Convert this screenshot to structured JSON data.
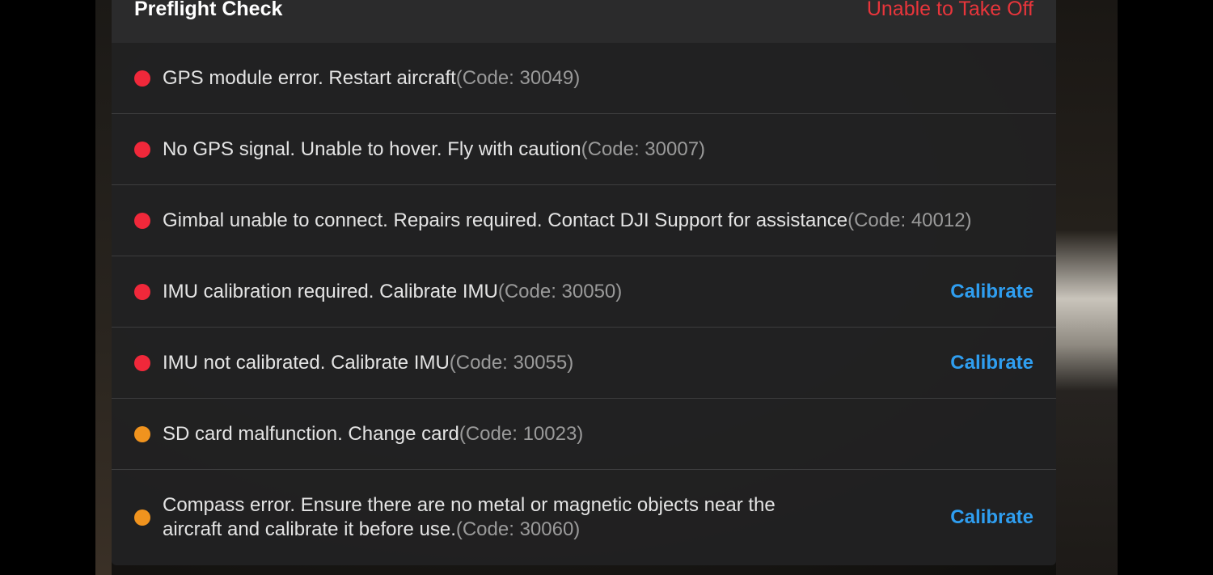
{
  "header": {
    "title": "Preflight Check",
    "status": "Unable to Take Off",
    "status_color": "#e8353b"
  },
  "colors": {
    "error": "#f0283a",
    "warning": "#f0931e",
    "action": "#2f9ef0"
  },
  "items": [
    {
      "severity": "error",
      "message": "GPS module error. Restart aircraft",
      "code": "(Code: 30049)",
      "action": null
    },
    {
      "severity": "error",
      "message": "No GPS signal. Unable to hover. Fly with caution",
      "code": "(Code: 30007)",
      "action": null
    },
    {
      "severity": "error",
      "message": "Gimbal unable to connect. Repairs required. Contact DJI Support for assistance",
      "code": "(Code: 40012)",
      "action": null
    },
    {
      "severity": "error",
      "message": "IMU calibration required. Calibrate IMU",
      "code": "(Code: 30050)",
      "action": "Calibrate"
    },
    {
      "severity": "error",
      "message": "IMU not calibrated. Calibrate IMU",
      "code": "(Code: 30055)",
      "action": "Calibrate"
    },
    {
      "severity": "warning",
      "message": "SD card malfunction. Change card",
      "code": "(Code: 10023)",
      "action": null
    },
    {
      "severity": "warning",
      "message": "Compass error. Ensure there are no metal or magnetic objects near the aircraft and calibrate it before use.",
      "code": "(Code: 30060)",
      "action": "Calibrate"
    }
  ]
}
